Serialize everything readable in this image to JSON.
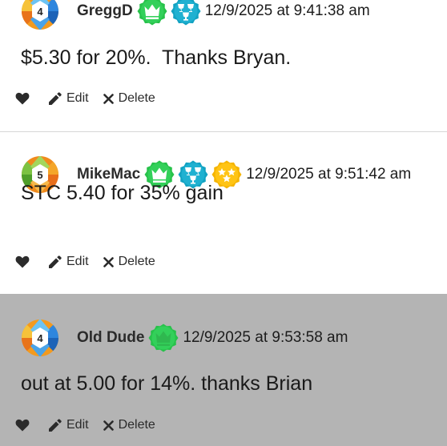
{
  "colors": {
    "badge_green": "#27c24a",
    "badge_teal": "#12a2c2",
    "badge_gold": "#f5b400",
    "highlight_bg": "#b4b4b4",
    "divider": "#d6d6d6"
  },
  "icons": {
    "like": "heart-icon",
    "edit": "pencil-icon",
    "delete": "close-icon"
  },
  "posts": [
    {
      "username": "GreggD",
      "avatar_level": "4",
      "badges": [
        "crown-badge",
        "trophies-badge"
      ],
      "timestamp": "12/9/2025 at 9:41:38 am",
      "message": "$5.30 for 20%.  Thanks Bryan.",
      "actions": {
        "edit_label": "Edit",
        "delete_label": "Delete"
      }
    },
    {
      "username": "MikeMac",
      "avatar_level": "5",
      "badges": [
        "crown-badge",
        "trophies-badge",
        "stars-badge"
      ],
      "timestamp": "12/9/2025 at 9:51:42 am",
      "message": "STC 5.40 for 35% gain",
      "actions": {
        "edit_label": "Edit",
        "delete_label": "Delete"
      }
    },
    {
      "username": "Old Dude",
      "avatar_level": "4",
      "badges": [
        "crown-badge"
      ],
      "timestamp": "12/9/2025 at 9:53:58 am",
      "message": "out at 5.00 for 14%. thanks Brian",
      "actions": {
        "edit_label": "Edit",
        "delete_label": "Delete"
      }
    }
  ]
}
